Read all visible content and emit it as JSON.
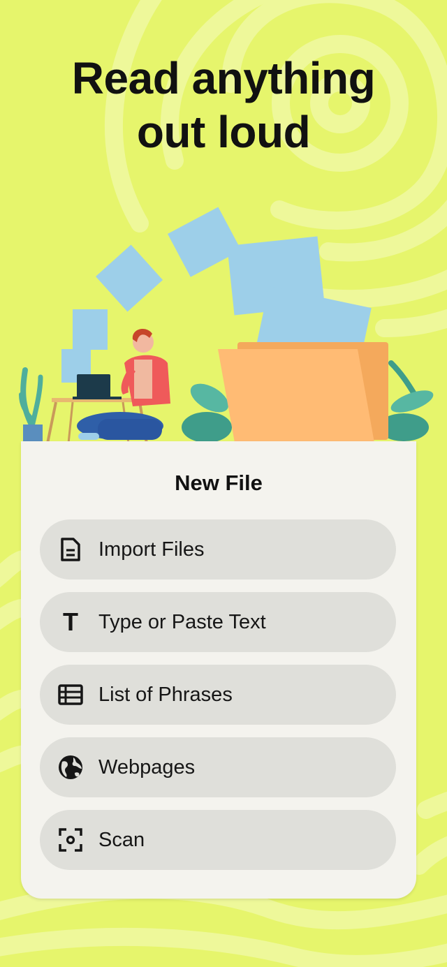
{
  "hero": {
    "headline_line1": "Read anything",
    "headline_line2": "out loud"
  },
  "colors": {
    "background": "#e6f56c",
    "swirl": "#eef89a",
    "card": "#f4f3ee",
    "option": "#dfdfda",
    "text": "#111111"
  },
  "card": {
    "title": "New File",
    "options": [
      {
        "label": "Import Files",
        "icon": "document-icon"
      },
      {
        "label": "Type or Paste Text",
        "icon": "text-t-icon"
      },
      {
        "label": "List of Phrases",
        "icon": "list-table-icon"
      },
      {
        "label": "Webpages",
        "icon": "globe-icon"
      },
      {
        "label": "Scan",
        "icon": "scan-icon"
      }
    ]
  }
}
